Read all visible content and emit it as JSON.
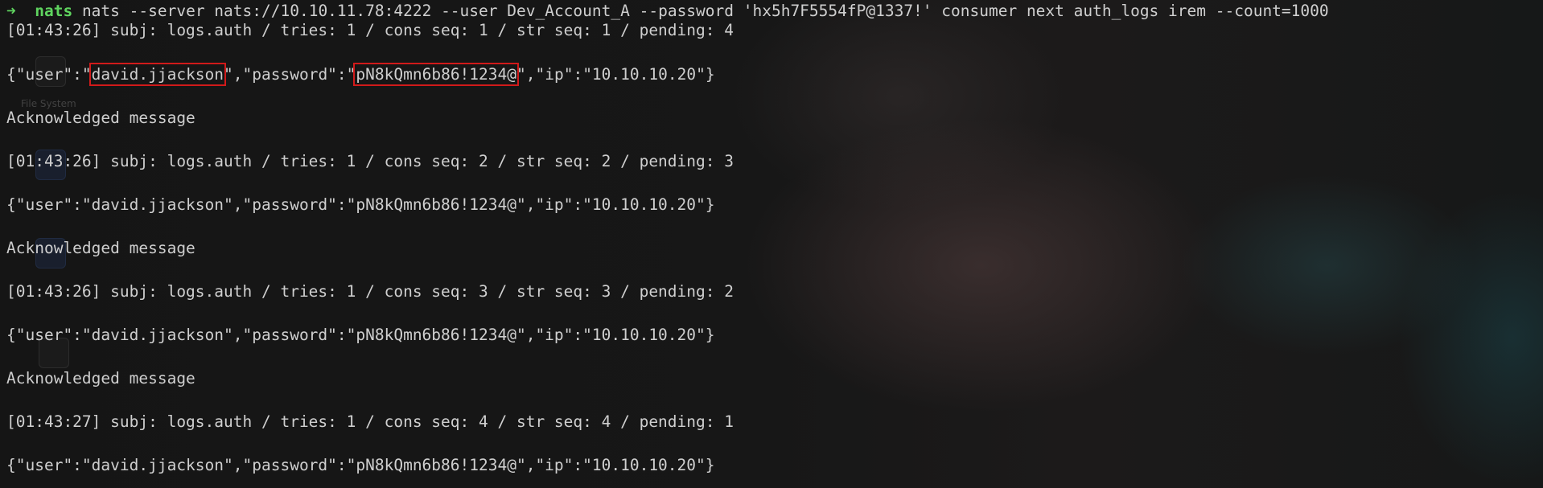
{
  "desktop": {
    "icon_label": "File System"
  },
  "terminal": {
    "prompt_symbol": "➜",
    "command_name": "nats",
    "command_args": " nats --server nats://10.10.11.78:4222 --user Dev_Account_A --password 'hx5h7F5554fP@1337!' consumer next auth_logs irem --count=1000",
    "messages": [
      {
        "header": "[01:43:26] subj: logs.auth / tries: 1 / cons seq: 1 / str seq: 1 / pending: 4",
        "payload_prefix": "{\"user\":\"",
        "user": "david.jjackson",
        "payload_mid": "\",\"password\":\"",
        "password": "pN8kQmn6b86!1234@",
        "payload_suffix": "\",\"ip\":\"10.10.10.20\"}",
        "ack": "Acknowledged message"
      },
      {
        "header": "[01:43:26] subj: logs.auth / tries: 1 / cons seq: 2 / str seq: 2 / pending: 3",
        "payload": "{\"user\":\"david.jjackson\",\"password\":\"pN8kQmn6b86!1234@\",\"ip\":\"10.10.10.20\"}",
        "ack": "Acknowledged message"
      },
      {
        "header": "[01:43:26] subj: logs.auth / tries: 1 / cons seq: 3 / str seq: 3 / pending: 2",
        "payload": "{\"user\":\"david.jjackson\",\"password\":\"pN8kQmn6b86!1234@\",\"ip\":\"10.10.10.20\"}",
        "ack": "Acknowledged message"
      },
      {
        "header": "[01:43:27] subj: logs.auth / tries: 1 / cons seq: 4 / str seq: 4 / pending: 1",
        "payload": "{\"user\":\"david.jjackson\",\"password\":\"pN8kQmn6b86!1234@\",\"ip\":\"10.10.10.20\"}"
      }
    ]
  },
  "colors": {
    "prompt_green": "#5fd45f",
    "text": "#cfcfcf",
    "highlight_box": "#d11a1a",
    "background": "#141414"
  }
}
